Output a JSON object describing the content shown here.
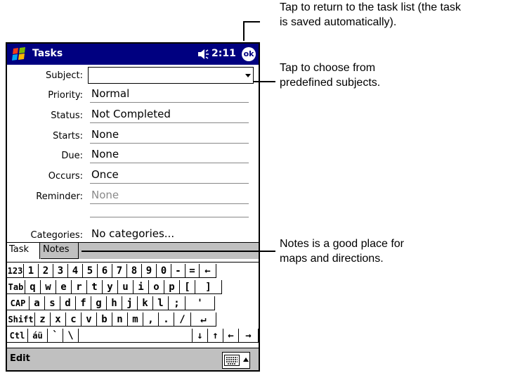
{
  "titlebar": {
    "app_title": "Tasks",
    "clock": "2:11",
    "ok_label": "ok"
  },
  "form": {
    "subject_label": "Subject:",
    "subject_value": "",
    "fields": [
      {
        "label": "Priority:",
        "value": "Normal"
      },
      {
        "label": "Status:",
        "value": "Not Completed"
      },
      {
        "label": "Starts:",
        "value": "None"
      },
      {
        "label": "Due:",
        "value": "None"
      },
      {
        "label": "Occurs:",
        "value": "Once"
      },
      {
        "label": "Reminder:",
        "value": "None"
      }
    ],
    "categories_label": "Categories:",
    "categories_value": "No categories..."
  },
  "tabs": [
    "Task",
    "Notes"
  ],
  "keyboard": {
    "rows": [
      [
        "123",
        "1",
        "2",
        "3",
        "4",
        "5",
        "6",
        "7",
        "8",
        "9",
        "0",
        "-",
        "=",
        "←"
      ],
      [
        "Tab",
        "q",
        "w",
        "e",
        "r",
        "t",
        "y",
        "u",
        "i",
        "o",
        "p",
        "[",
        "]"
      ],
      [
        "CAP",
        "a",
        "s",
        "d",
        "f",
        "g",
        "h",
        "j",
        "k",
        "l",
        ";",
        "'"
      ],
      [
        "Shift",
        "z",
        "x",
        "c",
        "v",
        "b",
        "n",
        "m",
        ",",
        ".",
        "/",
        "↵"
      ],
      [
        "Ctl",
        "áü",
        "`",
        "\\",
        "",
        "↓",
        "↑",
        "←",
        "→"
      ]
    ]
  },
  "menubar": {
    "edit_label": "Edit"
  },
  "callouts": {
    "ok": [
      "Tap to return to the task list (the task",
      "is saved automatically)."
    ],
    "subject": [
      "Tap to choose from",
      "predefined subjects."
    ],
    "notes": [
      "Notes is a good place for",
      "maps and directions."
    ]
  },
  "colors": {
    "titlebar": "#000080",
    "bars": "#c0c0c0",
    "dim_text": "#8a8a8a"
  }
}
